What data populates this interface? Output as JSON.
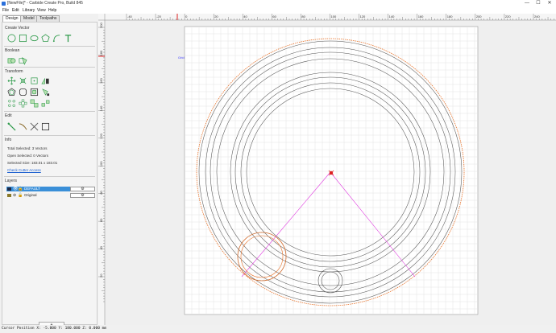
{
  "window": {
    "title": "[NewFile]* - Carbide Create Pro, Build 845",
    "controls": [
      "—",
      "☐",
      "✕"
    ]
  },
  "menu": [
    "File",
    "Edit",
    "Library",
    "View",
    "Help"
  ],
  "tabs": [
    {
      "label": "Design",
      "active": true
    },
    {
      "label": "Model",
      "active": false
    },
    {
      "label": "Toolpaths",
      "active": false
    }
  ],
  "sections": {
    "create_vector": "Create Vector",
    "boolean": "Boolean",
    "transform": "Transform",
    "edit": "Edit",
    "info": "Info",
    "layers": "Layers"
  },
  "info": {
    "total_selected": "Total Selected:   3 Vectors",
    "open_selected": "Open Selected:   0 Vectors",
    "selected_size": "Selected Size:    183.01 x 183.01",
    "check_cutter_access": "Check Cutter Access"
  },
  "layers": [
    {
      "name": "DEFAULT",
      "selected": true,
      "color": "#1f2a44"
    },
    {
      "name": "Original",
      "selected": false,
      "color": "#8a7a2a"
    }
  ],
  "add_layer_label": "+",
  "grid_label": "Grid",
  "ruler": {
    "x_labels": [
      "-40",
      "-20",
      "0",
      "20",
      "40",
      "60",
      "80",
      "100",
      "120",
      "140",
      "160",
      "180",
      "200",
      "220",
      "240"
    ],
    "y_labels": [
      "200",
      "180",
      "160",
      "140",
      "120",
      "100",
      "80",
      "60",
      "40",
      "20"
    ]
  },
  "status": {
    "cursor": "Cursor Position X: -5.000  Y: 180.000  Z: 0.000 mm"
  },
  "colors": {
    "orange": "#e8732a",
    "magenta": "#e040e0",
    "vector": "#555555",
    "selected_layer": "#3a8fd8"
  }
}
